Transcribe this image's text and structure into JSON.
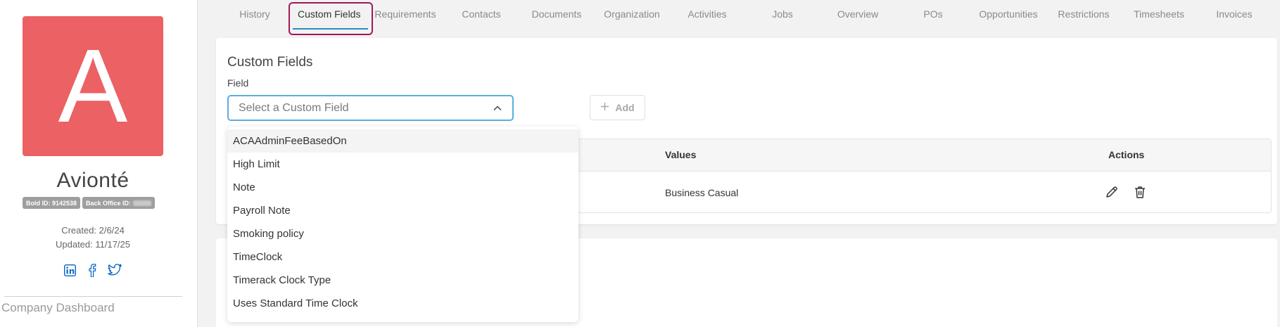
{
  "profile": {
    "avatar_letter": "A",
    "company_name": "Avionté",
    "bold_id_label": "Bold ID: 9142538",
    "back_office_label": "Back Office ID:",
    "created": "Created: 2/6/24",
    "updated": "Updated: 11/17/25",
    "socials": [
      "linkedin-icon",
      "facebook-icon",
      "twitter-icon"
    ],
    "dashboard_link": "Company Dashboard",
    "avatar_color": "#ec6163"
  },
  "tabs": [
    {
      "label": "History"
    },
    {
      "label": "Custom Fields",
      "active": true
    },
    {
      "label": "Requirements"
    },
    {
      "label": "Contacts"
    },
    {
      "label": "Documents"
    },
    {
      "label": "Organization"
    },
    {
      "label": "Activities"
    },
    {
      "label": "Jobs"
    },
    {
      "label": "Overview"
    },
    {
      "label": "POs"
    },
    {
      "label": "Opportunities"
    },
    {
      "label": "Restrictions"
    },
    {
      "label": "Timesheets"
    },
    {
      "label": "Invoices"
    }
  ],
  "custom_fields": {
    "title": "Custom Fields",
    "field_label": "Field",
    "select_placeholder": "Select a Custom Field",
    "add_label": "Add",
    "table": {
      "headers": {
        "values": "Values",
        "actions": "Actions"
      },
      "rows": [
        {
          "value": "Business Casual"
        }
      ]
    },
    "dropdown_options": [
      "ACAAdminFeeBasedOn",
      "High Limit",
      "Note",
      "Payroll Note",
      "Smoking policy",
      "TimeClock",
      "Timerack Clock Type",
      "Uses Standard Time Clock"
    ]
  },
  "colors": {
    "accent_blue": "#2a8ec4",
    "focus_outline": "#a0185b",
    "social_blue": "#0a66c2"
  }
}
